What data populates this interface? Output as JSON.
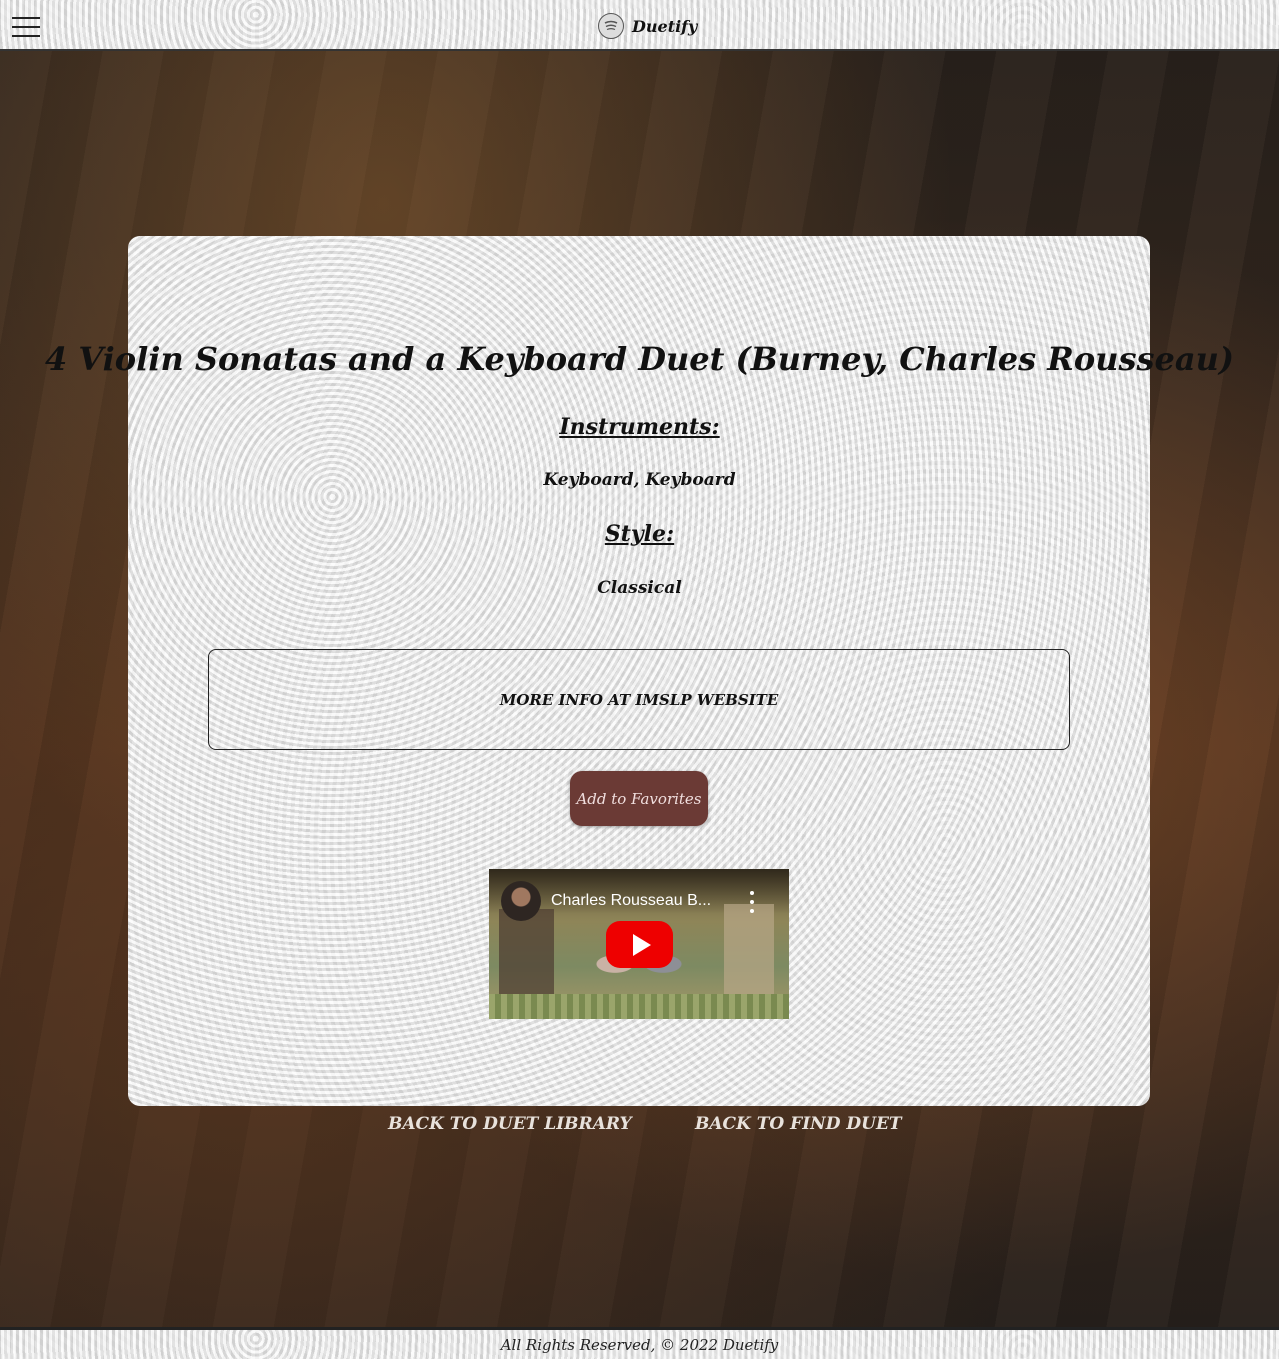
{
  "header": {
    "brand_name": "Duetify",
    "menu_icon": "hamburger-menu-icon",
    "logo_icon": "spotify-like-logo-icon"
  },
  "duet": {
    "title": "4 Violin Sonatas and a Keyboard Duet (Burney, Charles Rousseau)",
    "instruments_label": "Instruments:",
    "instruments_value": "Keyboard, Keyboard",
    "style_label": "Style:",
    "style_value": "Classical",
    "more_info_label": "MORE INFO AT IMSLP WEBSITE",
    "favorite_label": "Add to Favorites"
  },
  "video": {
    "title": "Charles Rousseau B...",
    "play_icon": "youtube-play-icon",
    "more_icon": "more-vertical-icon"
  },
  "nav": {
    "back_library": "BACK TO DUET LIBRARY",
    "back_find": "BACK TO FIND DUET"
  },
  "footer": {
    "text": "All Rights Reserved, © 2022 Duetify"
  },
  "colors": {
    "favorite_button": "#6b3a35",
    "youtube_red": "#ee0000"
  }
}
